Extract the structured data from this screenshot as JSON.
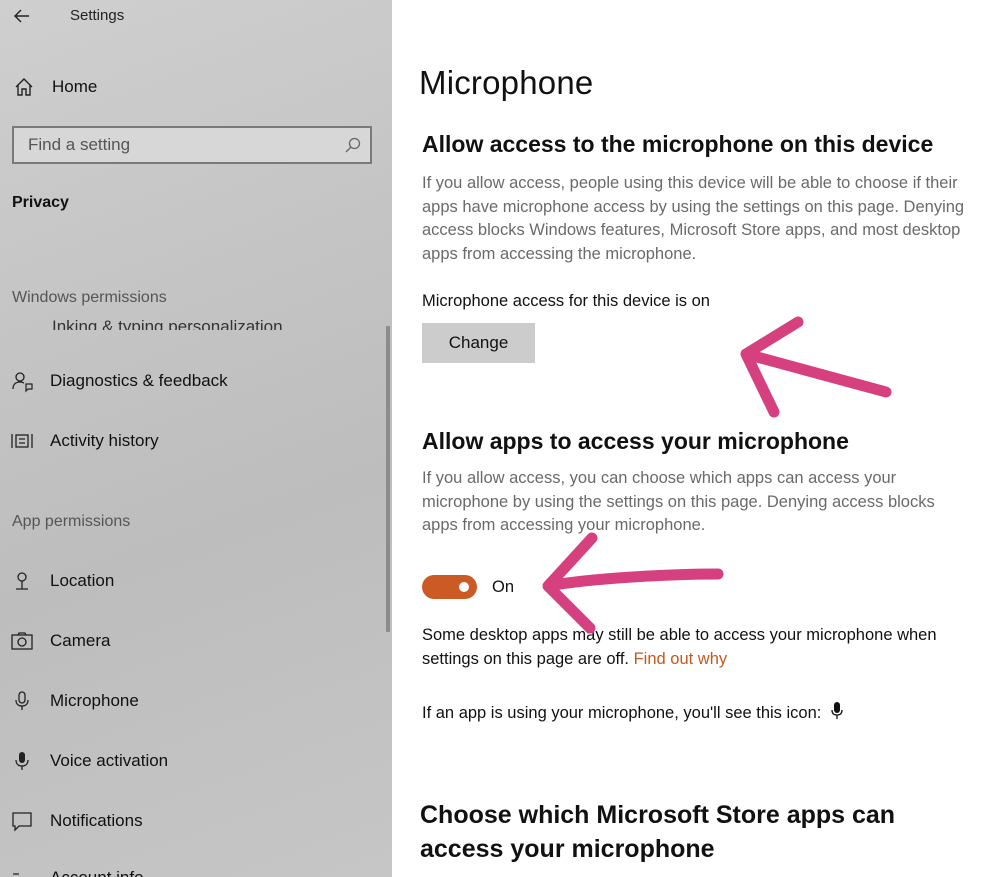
{
  "app": {
    "title": "Settings"
  },
  "sidebar": {
    "home_label": "Home",
    "search_placeholder": "Find a setting",
    "category": "Privacy",
    "windows_permissions_label": "Windows permissions",
    "partial_item_label": "Inking & typing personalization",
    "windows_items": [
      {
        "label": "Diagnostics & feedback",
        "icon": "person-feedback-icon"
      },
      {
        "label": "Activity history",
        "icon": "activity-history-icon"
      }
    ],
    "app_permissions_label": "App permissions",
    "app_items": [
      {
        "label": "Location",
        "icon": "location-pin-icon"
      },
      {
        "label": "Camera",
        "icon": "camera-icon"
      },
      {
        "label": "Microphone",
        "icon": "microphone-icon"
      },
      {
        "label": "Voice activation",
        "icon": "voice-activation-icon"
      },
      {
        "label": "Notifications",
        "icon": "notification-icon"
      },
      {
        "label": "Account info",
        "icon": "account-info-icon"
      }
    ]
  },
  "main": {
    "title": "Microphone",
    "device_section": {
      "heading": "Allow access to the microphone on this device",
      "description": "If you allow access, people using this device will be able to choose if their apps have microphone access by using the settings on this page. Denying access blocks Windows features, Microsoft Store apps, and most desktop apps from accessing the microphone.",
      "status": "Microphone access for this device is on",
      "change_label": "Change"
    },
    "apps_section": {
      "heading": "Allow apps to access your microphone",
      "description": "If you allow access, you can choose which apps can access your microphone by using the settings on this page. Denying access blocks apps from accessing your microphone.",
      "toggle_state": "On",
      "toggle_on": true
    },
    "note_text": "Some desktop apps may still be able to access your microphone when settings on this page are off.",
    "find_out_link": "Find out why",
    "icon_note": "If an app is using your microphone, you'll see this icon:",
    "store_section_heading": "Choose which Microsoft Store apps can access your microphone"
  },
  "colors": {
    "accent": "#cc5a24",
    "link": "#c25a1d",
    "annotation_arrow": "#d6407f"
  }
}
